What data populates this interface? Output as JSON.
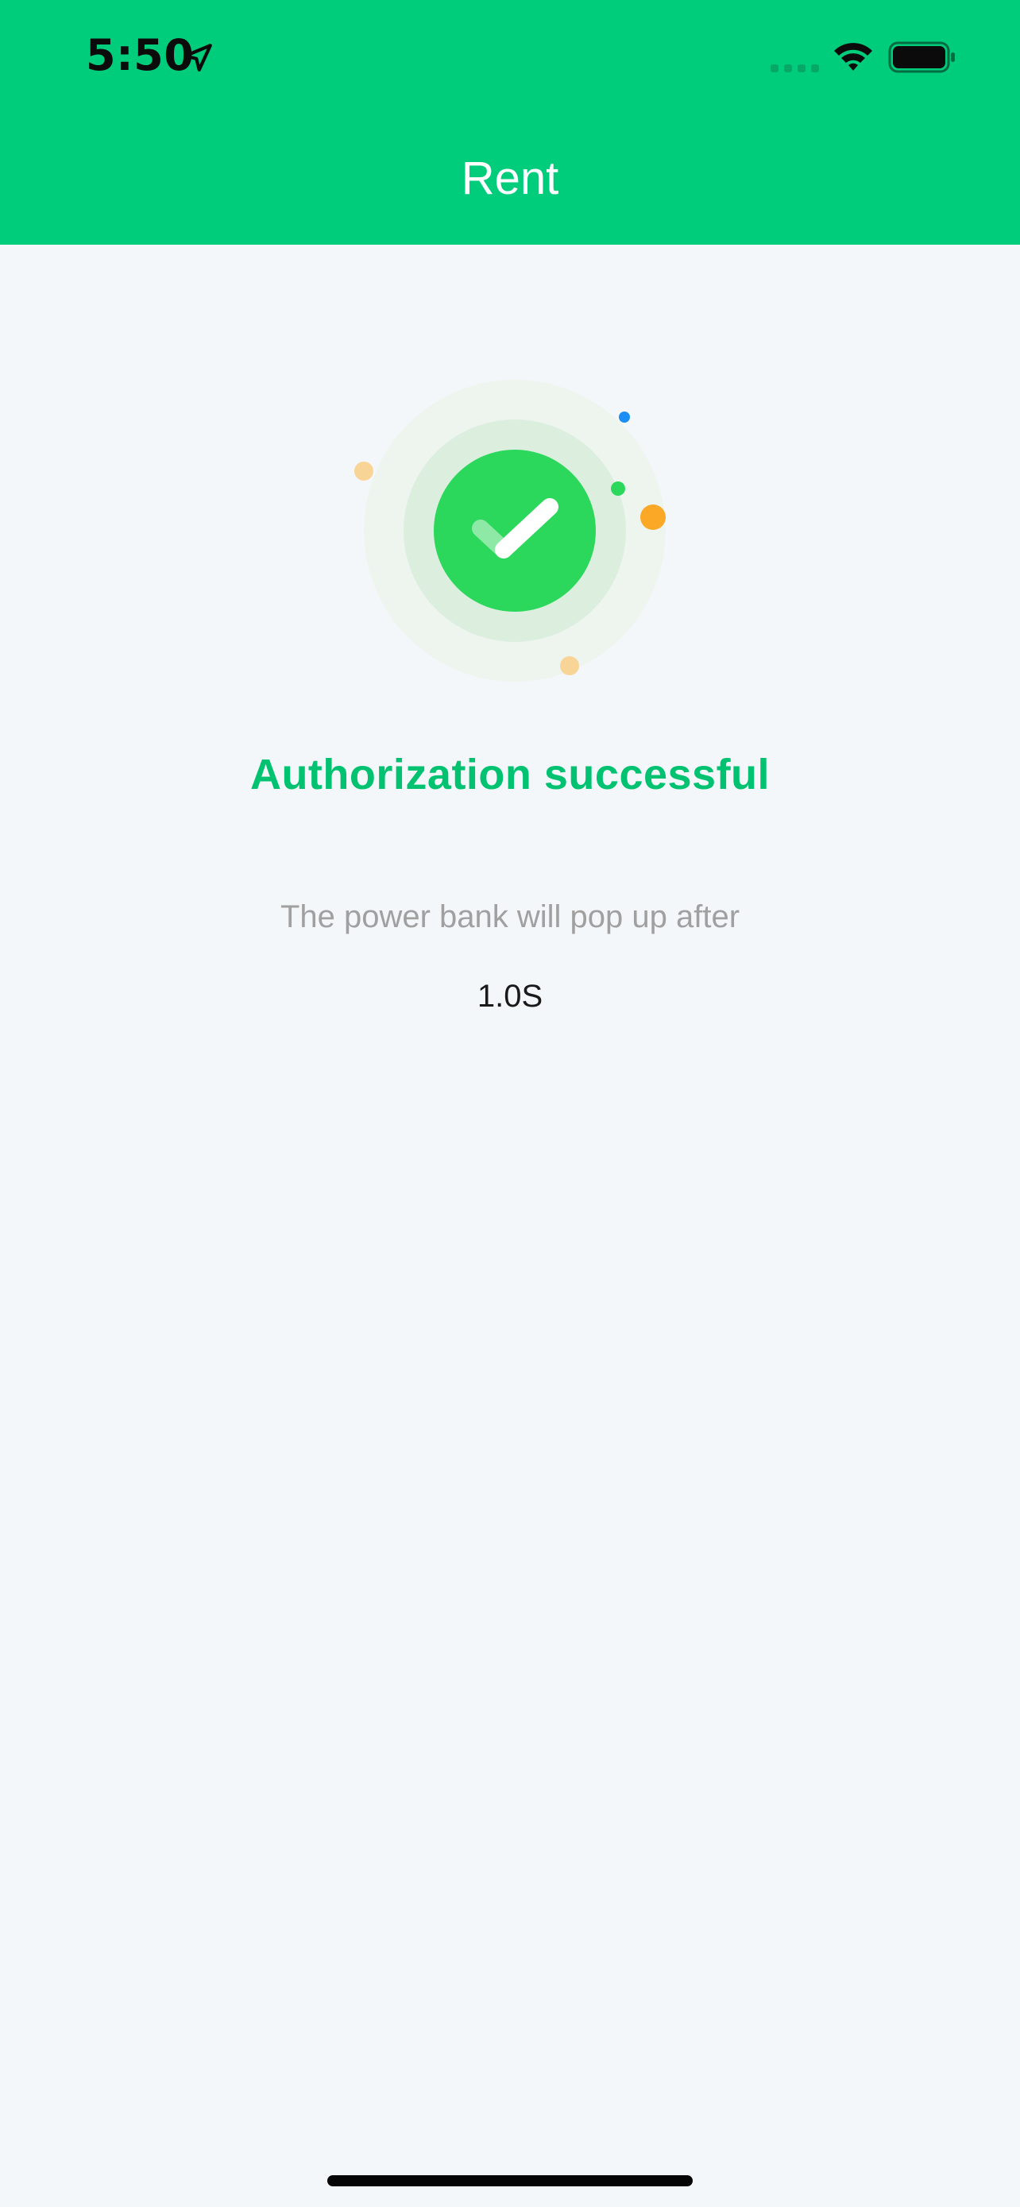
{
  "status_bar": {
    "time": "5:50",
    "icons": [
      "location-arrow-icon",
      "cellular-signal-icon",
      "wifi-icon",
      "battery-icon"
    ]
  },
  "header": {
    "title": "Rent",
    "background_color": "#00cd7b"
  },
  "main": {
    "illustration_icon": "success-checkmark-icon",
    "status_title": "Authorization successful",
    "status_title_color": "#00c270",
    "message": "The power bank will pop up after",
    "countdown": "1.0S"
  }
}
